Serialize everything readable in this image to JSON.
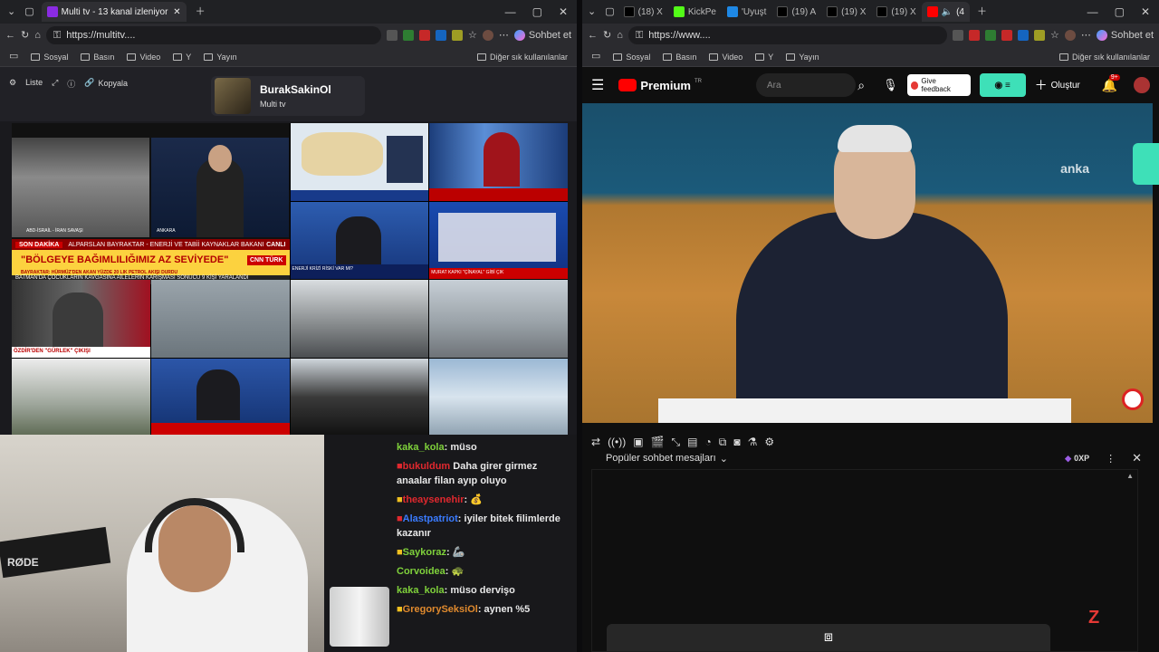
{
  "left_window": {
    "tabs": [
      {
        "label": "Multi tv - 13 kanal izleniyor",
        "active": true
      }
    ],
    "url": "https://multitv....",
    "sidebar_chat_button": "Sohbet et",
    "bookmarks": [
      "Sosyal",
      "Basın",
      "Video",
      "Y",
      "Yayın"
    ],
    "bookmarks_other": "Diğer sık kullanılanlar"
  },
  "multitv": {
    "buttons": {
      "list": "Liste",
      "copy": "Kopyala"
    },
    "profile": {
      "name": "BurakSakinOl",
      "subtitle": "Multi tv"
    },
    "ticker": {
      "top": "ALPARSLAN BAYRAKTAR - ENERJİ VE TABİİ KAYNAKLAR BAKANI",
      "label": "SON DAKİKA",
      "main": "\"BÖLGEYE BAĞIMLILIĞIMIZ AZ SEVİYEDE\"",
      "sub": "BAYRAKTAR: HÜRMÜZ'DEN AKAN YÜZDE 20 LIK PETROL AKIŞI DURDU",
      "bottom": "BATMAN'DA ÇOCUKLARIN KAVGASINA AİLELERİN KARIŞMASI SONUCU 9 KİŞİ YARALANDI",
      "channel": "CNN TÜRK",
      "live": "CANLI"
    },
    "cell_captions": {
      "ankara": "ANKARA",
      "abd": "ABD-İSRAİL - İRAN SAVAŞI",
      "ozdir": "ÖZDİR'DEN \"GÜRLEK\" ÇIKIŞI",
      "enerji": "ENERJİ KRİZİ RİSKİ VAR MI?",
      "murat": "MURAT KAPKI \"ÇİNAYAL\" GİBİ ÇIK"
    }
  },
  "stream_chat": {
    "messages": [
      {
        "user": "kaka_kola",
        "text": "müso",
        "color": "#7fd13b"
      },
      {
        "user": "bukuldum",
        "text": "Daha girer girmez anaalar filan ayıp oluyo",
        "color": "#e0282e"
      },
      {
        "user": "theaysenehir",
        "text": "",
        "color": "#e0282e"
      },
      {
        "user": "Alastpatriot",
        "text": "iyiler bitek filimlerde kazanır",
        "color": "#3a7bff"
      },
      {
        "user": "Saykoraz",
        "text": "",
        "color": "#7fd13b"
      },
      {
        "user": "Corvoidea",
        "text": "",
        "color": "#7fd13b"
      },
      {
        "user": "kaka_kola",
        "text": "müso dervişo",
        "color": "#7fd13b"
      },
      {
        "user": "GregorySeksiOl",
        "text": "aynen %5",
        "color": "#e08a2e"
      }
    ],
    "emotes": [
      "💰",
      "🐢",
      "🦾"
    ]
  },
  "right_window": {
    "tabs": [
      {
        "label": "(18) X"
      },
      {
        "label": "KickPe"
      },
      {
        "label": "'Uyuşt"
      },
      {
        "label": "(19) A"
      },
      {
        "label": "(19) X"
      },
      {
        "label": "(19) X"
      },
      {
        "label": "(4",
        "active": true
      }
    ],
    "url": "https://www....",
    "sidebar_chat_button": "Sohbet et",
    "bookmarks": [
      "Sosyal",
      "Basın",
      "Video",
      "Y",
      "Yayın"
    ],
    "bookmarks_other": "Diğer sık kullanılanlar"
  },
  "youtube": {
    "logo": "Premium",
    "logo_region": "TR",
    "search_placeholder": "Ara",
    "feedback": "Give feedback",
    "create": "Oluştur",
    "notifications": "9+",
    "watermark": "anka",
    "chat_mode": "Popüler sohbet mesajları",
    "xp": "0XP"
  },
  "colors": {
    "youtube_red": "#ff0000",
    "accent_teal": "#3ee0b8",
    "chat_bg": "#18181b"
  }
}
